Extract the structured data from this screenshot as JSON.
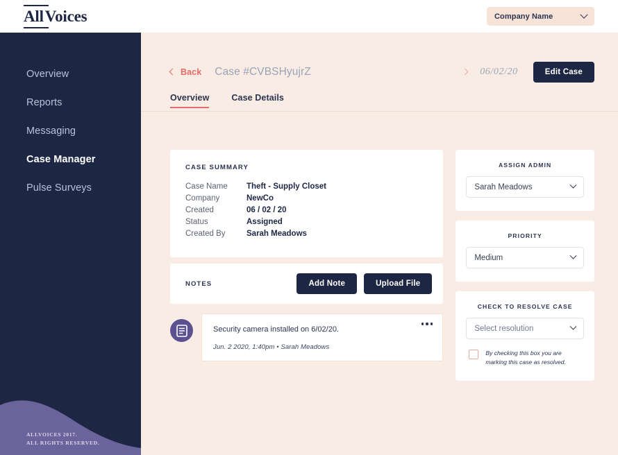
{
  "brand": {
    "logo_text": "AllVoices",
    "logo_prefix": "All",
    "logo_suffix": "Voices",
    "navy": "#1d2744",
    "peach_bg": "#f9ece4",
    "accent_red": "#e36b6b",
    "purple": "#5b5191"
  },
  "topbar": {
    "company_label": "Company Name",
    "chevron_icon": "chevron-down-icon"
  },
  "sidebar": {
    "items": [
      {
        "label": "Overview",
        "active": false
      },
      {
        "label": "Reports",
        "active": false
      },
      {
        "label": "Messaging",
        "active": false
      },
      {
        "label": "Case Manager",
        "active": true
      },
      {
        "label": "Pulse Surveys",
        "active": false
      }
    ],
    "footer_line1": "ALLVOICES 2017.",
    "footer_line2": "ALL RIGHTS RESERVED."
  },
  "page_head": {
    "back_label": "Back",
    "case_id": "Case #CVBSHyujrZ",
    "case_date": "06/02/20",
    "edit_button": "Edit Case",
    "back_icon": "chevron-left-icon",
    "forward_icon": "chevron-right-icon"
  },
  "tabs": [
    {
      "label": "Overview",
      "active": true
    },
    {
      "label": "Case Details",
      "active": false
    }
  ],
  "case_summary": {
    "title": "CASE SUMMARY",
    "rows": [
      {
        "key": "Case Name",
        "value": "Theft - Supply Closet"
      },
      {
        "key": "Company",
        "value": "NewCo"
      },
      {
        "key": "Created",
        "value": "06 / 02 / 20"
      },
      {
        "key": "Status",
        "value": "Assigned"
      },
      {
        "key": "Created By",
        "value": "Sarah Meadows"
      }
    ]
  },
  "notes": {
    "title": "NOTES",
    "add_note_button": "Add Note",
    "upload_file_button": "Upload File",
    "items": [
      {
        "avatar_icon": "document-icon",
        "text": "Security camera installed on 6/02/20.",
        "meta": "Jun. 2 2020, 1:40pm  •  Sarah Meadows",
        "menu_icon": "ellipsis-icon"
      }
    ]
  },
  "assign_admin": {
    "label": "ASSIGN ADMIN",
    "value": "Sarah Meadows"
  },
  "priority": {
    "label": "PRIORITY",
    "value": "Medium"
  },
  "resolve": {
    "label": "CHECK TO RESOLVE CASE",
    "placeholder": "Select resolution",
    "checkbox_text": "By checking this box you are marking this case as resolved."
  }
}
